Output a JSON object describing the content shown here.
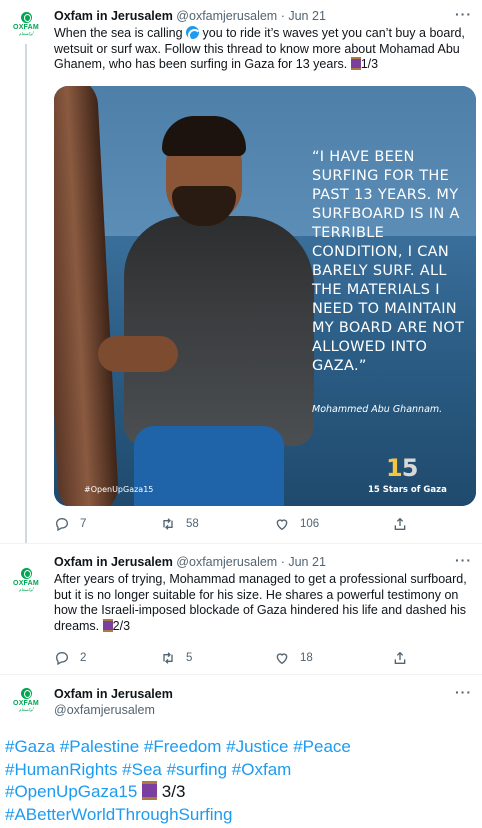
{
  "tweets": [
    {
      "name": "Oxfam in Jerusalem",
      "handle": "@oxfamjerusalem",
      "sep": "·",
      "date": "Jun 21",
      "text_1": "When the sea is calling ",
      "text_2": " you to ride it’s waves yet you can’t buy a board, wetsuit or surf wax. Follow this thread to know more about Mohamad Abu Ghanem, who has been surfing in Gaza for 13 years. ",
      "text_3": "1/3",
      "media": {
        "quote": "“I have been surfing for the past 13 years. My surfboard is in a terrible condition, I can barely surf. All the materials I need to maintain my board are not allowed into Gaza.”",
        "attribution": "Mohammed Abu Ghannam.",
        "hashtag": "#OpenUpGaza15",
        "logo_number_1": "1",
        "logo_number_5": "5",
        "logo_caption": "15 Stars of Gaza"
      },
      "replies": "7",
      "retweets": "58",
      "likes": "106"
    },
    {
      "name": "Oxfam in Jerusalem",
      "handle": "@oxfamjerusalem",
      "sep": "·",
      "date": "Jun 21",
      "text_1": "After years of trying, Mohammad managed to get a professional surfboard, but it is no longer suitable for his size. He shares a powerful testimony on how the Israeli-imposed blockade of Gaza hindered his life and dashed his dreams. ",
      "text_3": "2/3",
      "replies": "2",
      "retweets": "5",
      "likes": "18"
    },
    {
      "name": "Oxfam in Jerusalem",
      "handle": "@oxfamjerusalem",
      "hashtags_line1": "#Gaza #Palestine #Freedom #Justice #Peace",
      "hashtags_line2": "#HumanRights #Sea #surfing #Oxfam",
      "hashtags_line3_tag": "#OpenUpGaza15",
      "hashtags_line3_count": " 3/3",
      "hashtags_line4": "#ABetterWorldThroughSurfing"
    }
  ],
  "avatar": {
    "word": "OXFAM",
    "sub": "أوكسفام"
  },
  "more_label": "···",
  "colors": {
    "link": "#1d9bf0",
    "muted": "#536471",
    "oxfam_green": "#00a651"
  }
}
